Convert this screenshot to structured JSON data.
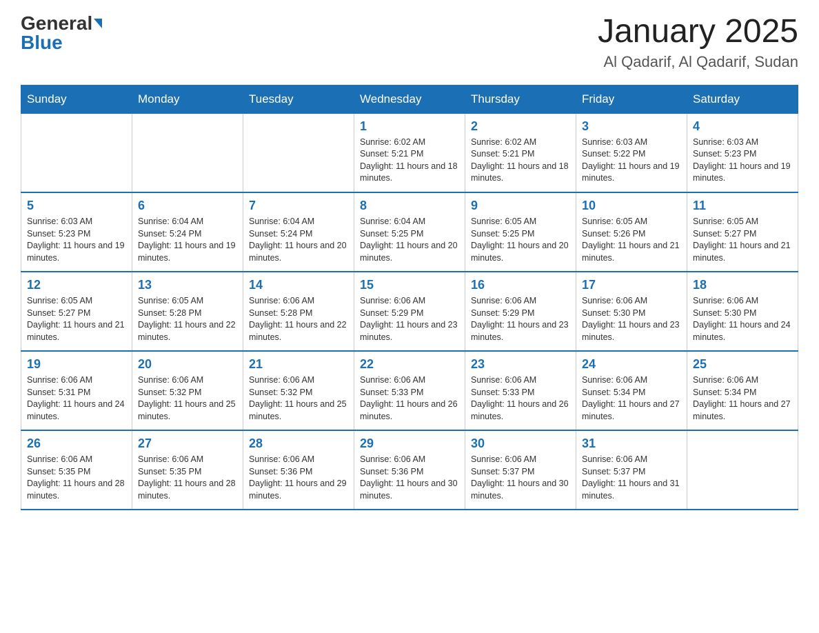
{
  "header": {
    "logo_general": "General",
    "logo_blue": "Blue",
    "title": "January 2025",
    "subtitle": "Al Qadarif, Al Qadarif, Sudan"
  },
  "days_of_week": [
    "Sunday",
    "Monday",
    "Tuesday",
    "Wednesday",
    "Thursday",
    "Friday",
    "Saturday"
  ],
  "weeks": [
    [
      {
        "day": "",
        "info": ""
      },
      {
        "day": "",
        "info": ""
      },
      {
        "day": "",
        "info": ""
      },
      {
        "day": "1",
        "info": "Sunrise: 6:02 AM\nSunset: 5:21 PM\nDaylight: 11 hours and 18 minutes."
      },
      {
        "day": "2",
        "info": "Sunrise: 6:02 AM\nSunset: 5:21 PM\nDaylight: 11 hours and 18 minutes."
      },
      {
        "day": "3",
        "info": "Sunrise: 6:03 AM\nSunset: 5:22 PM\nDaylight: 11 hours and 19 minutes."
      },
      {
        "day": "4",
        "info": "Sunrise: 6:03 AM\nSunset: 5:23 PM\nDaylight: 11 hours and 19 minutes."
      }
    ],
    [
      {
        "day": "5",
        "info": "Sunrise: 6:03 AM\nSunset: 5:23 PM\nDaylight: 11 hours and 19 minutes."
      },
      {
        "day": "6",
        "info": "Sunrise: 6:04 AM\nSunset: 5:24 PM\nDaylight: 11 hours and 19 minutes."
      },
      {
        "day": "7",
        "info": "Sunrise: 6:04 AM\nSunset: 5:24 PM\nDaylight: 11 hours and 20 minutes."
      },
      {
        "day": "8",
        "info": "Sunrise: 6:04 AM\nSunset: 5:25 PM\nDaylight: 11 hours and 20 minutes."
      },
      {
        "day": "9",
        "info": "Sunrise: 6:05 AM\nSunset: 5:25 PM\nDaylight: 11 hours and 20 minutes."
      },
      {
        "day": "10",
        "info": "Sunrise: 6:05 AM\nSunset: 5:26 PM\nDaylight: 11 hours and 21 minutes."
      },
      {
        "day": "11",
        "info": "Sunrise: 6:05 AM\nSunset: 5:27 PM\nDaylight: 11 hours and 21 minutes."
      }
    ],
    [
      {
        "day": "12",
        "info": "Sunrise: 6:05 AM\nSunset: 5:27 PM\nDaylight: 11 hours and 21 minutes."
      },
      {
        "day": "13",
        "info": "Sunrise: 6:05 AM\nSunset: 5:28 PM\nDaylight: 11 hours and 22 minutes."
      },
      {
        "day": "14",
        "info": "Sunrise: 6:06 AM\nSunset: 5:28 PM\nDaylight: 11 hours and 22 minutes."
      },
      {
        "day": "15",
        "info": "Sunrise: 6:06 AM\nSunset: 5:29 PM\nDaylight: 11 hours and 23 minutes."
      },
      {
        "day": "16",
        "info": "Sunrise: 6:06 AM\nSunset: 5:29 PM\nDaylight: 11 hours and 23 minutes."
      },
      {
        "day": "17",
        "info": "Sunrise: 6:06 AM\nSunset: 5:30 PM\nDaylight: 11 hours and 23 minutes."
      },
      {
        "day": "18",
        "info": "Sunrise: 6:06 AM\nSunset: 5:30 PM\nDaylight: 11 hours and 24 minutes."
      }
    ],
    [
      {
        "day": "19",
        "info": "Sunrise: 6:06 AM\nSunset: 5:31 PM\nDaylight: 11 hours and 24 minutes."
      },
      {
        "day": "20",
        "info": "Sunrise: 6:06 AM\nSunset: 5:32 PM\nDaylight: 11 hours and 25 minutes."
      },
      {
        "day": "21",
        "info": "Sunrise: 6:06 AM\nSunset: 5:32 PM\nDaylight: 11 hours and 25 minutes."
      },
      {
        "day": "22",
        "info": "Sunrise: 6:06 AM\nSunset: 5:33 PM\nDaylight: 11 hours and 26 minutes."
      },
      {
        "day": "23",
        "info": "Sunrise: 6:06 AM\nSunset: 5:33 PM\nDaylight: 11 hours and 26 minutes."
      },
      {
        "day": "24",
        "info": "Sunrise: 6:06 AM\nSunset: 5:34 PM\nDaylight: 11 hours and 27 minutes."
      },
      {
        "day": "25",
        "info": "Sunrise: 6:06 AM\nSunset: 5:34 PM\nDaylight: 11 hours and 27 minutes."
      }
    ],
    [
      {
        "day": "26",
        "info": "Sunrise: 6:06 AM\nSunset: 5:35 PM\nDaylight: 11 hours and 28 minutes."
      },
      {
        "day": "27",
        "info": "Sunrise: 6:06 AM\nSunset: 5:35 PM\nDaylight: 11 hours and 28 minutes."
      },
      {
        "day": "28",
        "info": "Sunrise: 6:06 AM\nSunset: 5:36 PM\nDaylight: 11 hours and 29 minutes."
      },
      {
        "day": "29",
        "info": "Sunrise: 6:06 AM\nSunset: 5:36 PM\nDaylight: 11 hours and 30 minutes."
      },
      {
        "day": "30",
        "info": "Sunrise: 6:06 AM\nSunset: 5:37 PM\nDaylight: 11 hours and 30 minutes."
      },
      {
        "day": "31",
        "info": "Sunrise: 6:06 AM\nSunset: 5:37 PM\nDaylight: 11 hours and 31 minutes."
      },
      {
        "day": "",
        "info": ""
      }
    ]
  ]
}
